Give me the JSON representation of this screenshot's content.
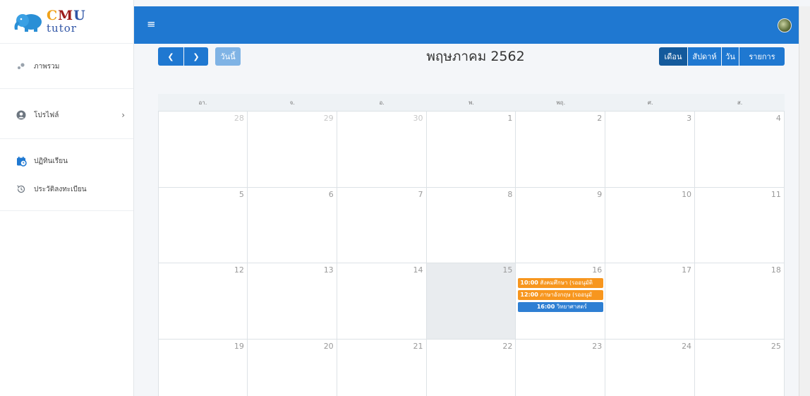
{
  "brand": {
    "main_c": "C",
    "main_m": "M",
    "main_u": "U",
    "sub": "tutor"
  },
  "sidebar": {
    "items": [
      {
        "label": "ภาพรวม",
        "icon": "dashboard-icon"
      },
      {
        "label": "โปรไฟล์",
        "icon": "user-icon"
      },
      {
        "label": "ปฏิทินเรียน",
        "icon": "calendar-icon"
      },
      {
        "label": "ประวัติลงทะเบียน",
        "icon": "history-icon"
      }
    ]
  },
  "calendar": {
    "title": "พฤษภาคม 2562",
    "today_label": "วันนี้",
    "views": {
      "month": "เดือน",
      "week": "สัปดาห์",
      "day": "วัน",
      "list": "รายการ"
    },
    "weekdays": [
      "อา.",
      "จ.",
      "อ.",
      "พ.",
      "พฤ.",
      "ศ.",
      "ส."
    ],
    "weeks": [
      [
        "28",
        "29",
        "30",
        "1",
        "2",
        "3",
        "4"
      ],
      [
        "5",
        "6",
        "7",
        "8",
        "9",
        "10",
        "11"
      ],
      [
        "12",
        "13",
        "14",
        "15",
        "16",
        "17",
        "18"
      ],
      [
        "19",
        "20",
        "21",
        "22",
        "23",
        "24",
        "25"
      ]
    ],
    "events": [
      {
        "time": "10:00",
        "title": "สังคมศึกษา (รออนุมัติ",
        "color": "#f7961e"
      },
      {
        "time": "12:00",
        "title": "ภาษาอังกฤษ (รออนุมั",
        "color": "#f7961e"
      },
      {
        "time": "16:00",
        "title": "วิทยาศาสตร์",
        "color": "#2e7fd3"
      }
    ]
  },
  "colors": {
    "topbar": "#1f78d1",
    "accent": "#1f78d1",
    "active_view": "#145a9c",
    "pending": "#f7961e"
  }
}
